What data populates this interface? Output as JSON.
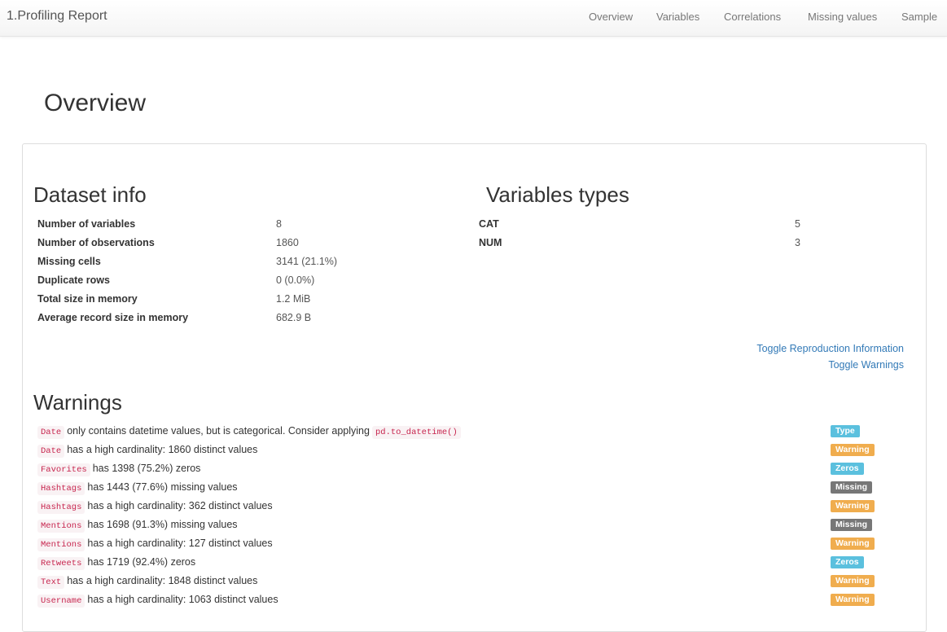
{
  "brand": "1.Profiling Report",
  "nav": [
    "Overview",
    "Variables",
    "Correlations",
    "Missing values",
    "Sample"
  ],
  "page_title": "Overview",
  "dataset_info": {
    "title": "Dataset info",
    "rows": [
      {
        "key": "Number of variables",
        "value": "8"
      },
      {
        "key": "Number of observations",
        "value": "1860"
      },
      {
        "key": "Missing cells",
        "value": "3141 (21.1%)"
      },
      {
        "key": "Duplicate rows",
        "value": "0 (0.0%)"
      },
      {
        "key": "Total size in memory",
        "value": "1.2 MiB"
      },
      {
        "key": "Average record size in memory",
        "value": "682.9 B"
      }
    ]
  },
  "variable_types": {
    "title": "Variables types",
    "rows": [
      {
        "key": "CAT",
        "value": "5"
      },
      {
        "key": "NUM",
        "value": "3"
      }
    ]
  },
  "toggles": {
    "reproduction": "Toggle Reproduction Information",
    "warnings": "Toggle Warnings"
  },
  "warnings": {
    "title": "Warnings",
    "items": [
      {
        "var": "Date",
        "text": "only contains datetime values, but is categorical. Consider applying",
        "code": "pd.to_datetime()",
        "badge": "Type",
        "badge_class": "type"
      },
      {
        "var": "Date",
        "text": "has a high cardinality: 1860 distinct values",
        "badge": "Warning",
        "badge_class": "warning"
      },
      {
        "var": "Favorites",
        "text": "has 1398 (75.2%) zeros",
        "badge": "Zeros",
        "badge_class": "zeros"
      },
      {
        "var": "Hashtags",
        "text": "has 1443 (77.6%) missing values",
        "badge": "Missing",
        "badge_class": "missing"
      },
      {
        "var": "Hashtags",
        "text": "has a high cardinality: 362 distinct values",
        "badge": "Warning",
        "badge_class": "warning"
      },
      {
        "var": "Mentions",
        "text": "has 1698 (91.3%) missing values",
        "badge": "Missing",
        "badge_class": "missing"
      },
      {
        "var": "Mentions",
        "text": "has a high cardinality: 127 distinct values",
        "badge": "Warning",
        "badge_class": "warning"
      },
      {
        "var": "Retweets",
        "text": "has 1719 (92.4%) zeros",
        "badge": "Zeros",
        "badge_class": "zeros"
      },
      {
        "var": "Text",
        "text": "has a high cardinality: 1848 distinct values",
        "badge": "Warning",
        "badge_class": "warning"
      },
      {
        "var": "Username",
        "text": "has a high cardinality: 1063 distinct values",
        "badge": "Warning",
        "badge_class": "warning"
      }
    ]
  },
  "colors": {
    "link": "#337ab7",
    "code_text": "#c7254e",
    "badge_info": "#5bc0de",
    "badge_warning": "#f0ad4e",
    "badge_missing": "#777777"
  }
}
